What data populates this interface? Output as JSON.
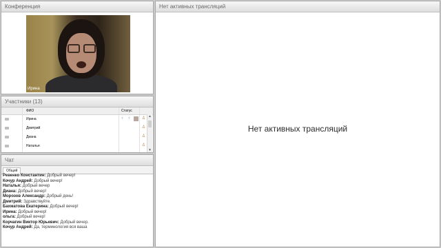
{
  "conference": {
    "title": "Конференция",
    "speaker_name": "Ирина"
  },
  "participants": {
    "title": "Участники (13)",
    "columns": {
      "name": "ФИО",
      "status": "Статус"
    },
    "rows": [
      {
        "name": "Ирина",
        "icons": [
          "mic-icon",
          "camera-icon",
          "screen-icon",
          "user-icon"
        ]
      },
      {
        "name": "Дмитрий",
        "icons": [
          "user-icon"
        ]
      },
      {
        "name": "Диана",
        "icons": [
          "user-icon"
        ]
      },
      {
        "name": "Наталья",
        "icons": [
          "user-icon"
        ]
      },
      {
        "name": "",
        "icons": []
      }
    ]
  },
  "chat": {
    "title": "Чат",
    "tab": "Общий",
    "messages": [
      {
        "author": "Ревенко Константин:",
        "text": "Добрый вечер!"
      },
      {
        "author": "Кочур Андрей:",
        "text": "Добрый вечер!"
      },
      {
        "author": "Наталья:",
        "text": "Добрый вечер"
      },
      {
        "author": "Диана:",
        "text": "Добрый вечер!"
      },
      {
        "author": "Морозов Александр:",
        "text": "Добрый день!"
      },
      {
        "author": "Дмитрий:",
        "text": "Здравствуйте."
      },
      {
        "author": "Бахматова Екатерина:",
        "text": "Добрый вечер!"
      },
      {
        "author": "Ирина:",
        "text": "Добрый вечер!"
      },
      {
        "author": "ольга:",
        "text": "Добрый вечер!"
      },
      {
        "author": "Корчагин Виктор Юрьевич:",
        "text": "Добрый вечер."
      },
      {
        "author": "Кочур Андрей:",
        "text": "Да, терминология вся ваша"
      }
    ]
  },
  "broadcast": {
    "title": "Нет активных трансляций",
    "empty_message": "Нет активных трансляций"
  }
}
